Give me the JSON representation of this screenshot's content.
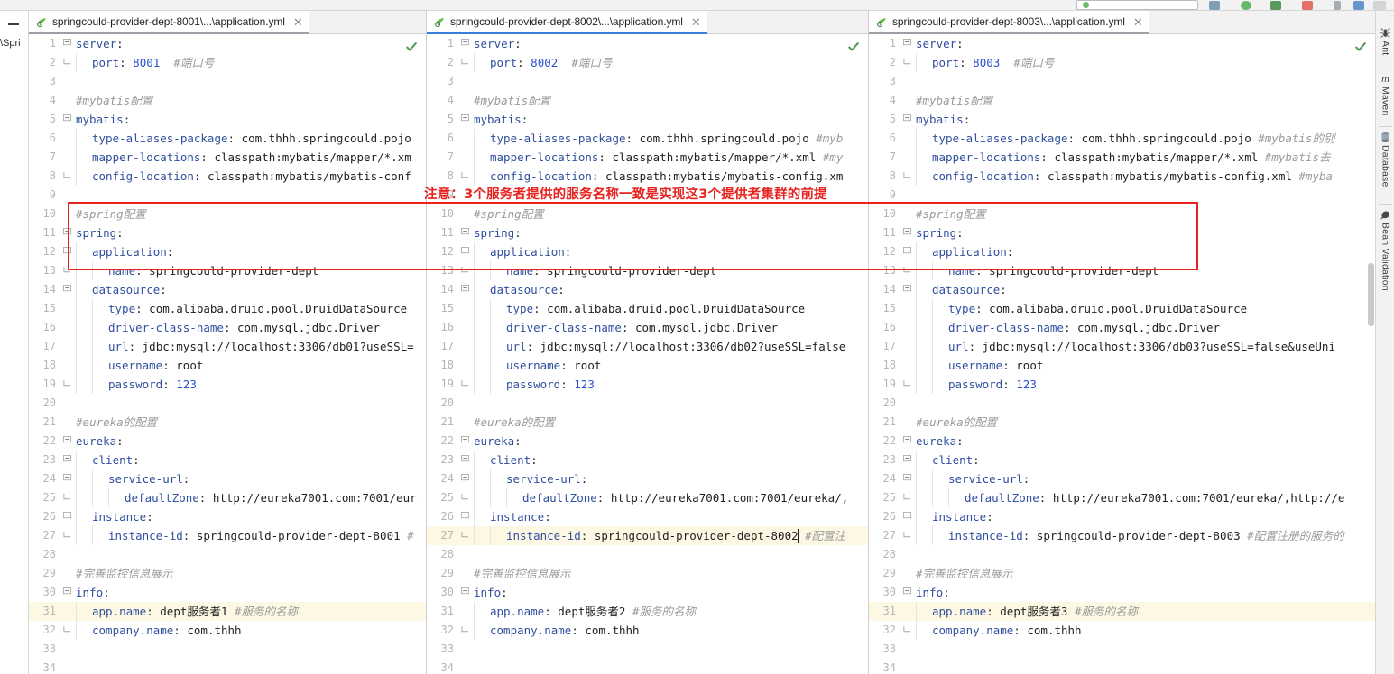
{
  "window": {
    "minimize_label": "—",
    "left_sliver_text": "\\Spri"
  },
  "annotation": {
    "text": "注意：3个服务者提供的服务名称一致是实现这3个提供者集群的前提",
    "color": "#e8231f"
  },
  "right_sidebar": {
    "items": [
      {
        "label": "Ant",
        "icon": "ant-icon"
      },
      {
        "label": "Maven",
        "icon": "maven-icon"
      },
      {
        "label": "Database",
        "icon": "database-icon"
      },
      {
        "label": "Bean Validation",
        "icon": "bean-validation-icon"
      }
    ]
  },
  "panes": [
    {
      "id": "pane-1",
      "tab": {
        "label": "springcould-provider-dept-8001\\...\\application.yml",
        "close": "✕",
        "icon": "spring-yml-icon",
        "active_style": "active-grey"
      },
      "inspection_status": "ok",
      "lines": [
        {
          "n": 1,
          "fold": "minus",
          "indent": 0,
          "text": "server:"
        },
        {
          "n": 2,
          "fold": "end",
          "indent": 1,
          "text": "port: 8001  #端口号"
        },
        {
          "n": 3,
          "fold": "",
          "indent": 0,
          "text": ""
        },
        {
          "n": 4,
          "fold": "",
          "indent": 0,
          "text": "#mybatis配置"
        },
        {
          "n": 5,
          "fold": "minus",
          "indent": 0,
          "text": "mybatis:"
        },
        {
          "n": 6,
          "fold": "",
          "indent": 1,
          "text": "type-aliases-package: com.thhh.springcould.pojo"
        },
        {
          "n": 7,
          "fold": "",
          "indent": 1,
          "text": "mapper-locations: classpath:mybatis/mapper/*.xm"
        },
        {
          "n": 8,
          "fold": "end",
          "indent": 1,
          "text": "config-location: classpath:mybatis/mybatis-conf"
        },
        {
          "n": 9,
          "fold": "",
          "indent": 0,
          "text": ""
        },
        {
          "n": 10,
          "fold": "",
          "indent": 0,
          "text": "#spring配置"
        },
        {
          "n": 11,
          "fold": "minus",
          "indent": 0,
          "text": "spring:"
        },
        {
          "n": 12,
          "fold": "minus",
          "indent": 1,
          "text": "application:"
        },
        {
          "n": 13,
          "fold": "end",
          "indent": 2,
          "text": "name: springcould-provider-dept"
        },
        {
          "n": 14,
          "fold": "minus",
          "indent": 1,
          "text": "datasource:"
        },
        {
          "n": 15,
          "fold": "",
          "indent": 2,
          "text": "type: com.alibaba.druid.pool.DruidDataSource"
        },
        {
          "n": 16,
          "fold": "",
          "indent": 2,
          "text": "driver-class-name: com.mysql.jdbc.Driver"
        },
        {
          "n": 17,
          "fold": "",
          "indent": 2,
          "text": "url: jdbc:mysql://localhost:3306/db01?useSSL="
        },
        {
          "n": 18,
          "fold": "",
          "indent": 2,
          "text": "username: root"
        },
        {
          "n": 19,
          "fold": "end",
          "indent": 2,
          "text": "password: 123"
        },
        {
          "n": 20,
          "fold": "",
          "indent": 0,
          "text": ""
        },
        {
          "n": 21,
          "fold": "",
          "indent": 0,
          "text": "#eureka的配置"
        },
        {
          "n": 22,
          "fold": "minus",
          "indent": 0,
          "text": "eureka:"
        },
        {
          "n": 23,
          "fold": "minus",
          "indent": 1,
          "text": "client:"
        },
        {
          "n": 24,
          "fold": "minus",
          "indent": 2,
          "text": "service-url:"
        },
        {
          "n": 25,
          "fold": "end",
          "indent": 3,
          "text": "defaultZone: http://eureka7001.com:7001/eur"
        },
        {
          "n": 26,
          "fold": "minus",
          "indent": 1,
          "text": "instance:"
        },
        {
          "n": 27,
          "fold": "end",
          "indent": 2,
          "text": "instance-id: springcould-provider-dept-8001 #"
        },
        {
          "n": 28,
          "fold": "",
          "indent": 0,
          "text": ""
        },
        {
          "n": 29,
          "fold": "",
          "indent": 0,
          "text": "#完善监控信息展示"
        },
        {
          "n": 30,
          "fold": "minus",
          "indent": 0,
          "text": "info:"
        },
        {
          "n": 31,
          "fold": "",
          "indent": 1,
          "text": "app.name: dept服务者1 #服务的名称",
          "highlight": true
        },
        {
          "n": 32,
          "fold": "end",
          "indent": 1,
          "text": "company.name: com.thhh"
        },
        {
          "n": 33,
          "fold": "",
          "indent": 0,
          "text": ""
        },
        {
          "n": 34,
          "fold": "",
          "indent": 0,
          "text": ""
        }
      ]
    },
    {
      "id": "pane-2",
      "tab": {
        "label": "springcould-provider-dept-8002\\...\\application.yml",
        "close": "✕",
        "icon": "spring-yml-icon",
        "active_style": "active-blue"
      },
      "inspection_status": "ok",
      "lines": [
        {
          "n": 1,
          "fold": "minus",
          "indent": 0,
          "text": "server:"
        },
        {
          "n": 2,
          "fold": "end",
          "indent": 1,
          "text": "port: 8002  #端口号"
        },
        {
          "n": 3,
          "fold": "",
          "indent": 0,
          "text": ""
        },
        {
          "n": 4,
          "fold": "",
          "indent": 0,
          "text": "#mybatis配置"
        },
        {
          "n": 5,
          "fold": "minus",
          "indent": 0,
          "text": "mybatis:"
        },
        {
          "n": 6,
          "fold": "",
          "indent": 1,
          "text": "type-aliases-package: com.thhh.springcould.pojo #myb"
        },
        {
          "n": 7,
          "fold": "",
          "indent": 1,
          "text": "mapper-locations: classpath:mybatis/mapper/*.xml #my"
        },
        {
          "n": 8,
          "fold": "end",
          "indent": 1,
          "text": "config-location: classpath:mybatis/mybatis-config.xm"
        },
        {
          "n": 9,
          "fold": "",
          "indent": 0,
          "text": ""
        },
        {
          "n": 10,
          "fold": "",
          "indent": 0,
          "text": "#spring配置"
        },
        {
          "n": 11,
          "fold": "minus",
          "indent": 0,
          "text": "spring:"
        },
        {
          "n": 12,
          "fold": "minus",
          "indent": 1,
          "text": "application:"
        },
        {
          "n": 13,
          "fold": "end",
          "indent": 2,
          "text": "name: springcould-provider-dept"
        },
        {
          "n": 14,
          "fold": "minus",
          "indent": 1,
          "text": "datasource:"
        },
        {
          "n": 15,
          "fold": "",
          "indent": 2,
          "text": "type: com.alibaba.druid.pool.DruidDataSource"
        },
        {
          "n": 16,
          "fold": "",
          "indent": 2,
          "text": "driver-class-name: com.mysql.jdbc.Driver"
        },
        {
          "n": 17,
          "fold": "",
          "indent": 2,
          "text": "url: jdbc:mysql://localhost:3306/db02?useSSL=false"
        },
        {
          "n": 18,
          "fold": "",
          "indent": 2,
          "text": "username: root"
        },
        {
          "n": 19,
          "fold": "end",
          "indent": 2,
          "text": "password: 123"
        },
        {
          "n": 20,
          "fold": "",
          "indent": 0,
          "text": ""
        },
        {
          "n": 21,
          "fold": "",
          "indent": 0,
          "text": "#eureka的配置"
        },
        {
          "n": 22,
          "fold": "minus",
          "indent": 0,
          "text": "eureka:"
        },
        {
          "n": 23,
          "fold": "minus",
          "indent": 1,
          "text": "client:"
        },
        {
          "n": 24,
          "fold": "minus",
          "indent": 2,
          "text": "service-url:"
        },
        {
          "n": 25,
          "fold": "end",
          "indent": 3,
          "text": "defaultZone: http://eureka7001.com:7001/eureka/,"
        },
        {
          "n": 26,
          "fold": "minus",
          "indent": 1,
          "text": "instance:"
        },
        {
          "n": 27,
          "fold": "end",
          "indent": 2,
          "text": "instance-id: springcould-provider-dept-8002 #配置注",
          "highlight": true,
          "caret_after": "instance-id: springcould-provider-dept-8002"
        },
        {
          "n": 28,
          "fold": "",
          "indent": 0,
          "text": ""
        },
        {
          "n": 29,
          "fold": "",
          "indent": 0,
          "text": "#完善监控信息展示"
        },
        {
          "n": 30,
          "fold": "minus",
          "indent": 0,
          "text": "info:"
        },
        {
          "n": 31,
          "fold": "",
          "indent": 1,
          "text": "app.name: dept服务者2 #服务的名称"
        },
        {
          "n": 32,
          "fold": "end",
          "indent": 1,
          "text": "company.name: com.thhh"
        },
        {
          "n": 33,
          "fold": "",
          "indent": 0,
          "text": ""
        },
        {
          "n": 34,
          "fold": "",
          "indent": 0,
          "text": ""
        }
      ]
    },
    {
      "id": "pane-3",
      "tab": {
        "label": "springcould-provider-dept-8003\\...\\application.yml",
        "close": "✕",
        "icon": "spring-yml-icon",
        "active_style": "active-grey"
      },
      "inspection_status": "ok",
      "lines": [
        {
          "n": 1,
          "fold": "minus",
          "indent": 0,
          "text": "server:"
        },
        {
          "n": 2,
          "fold": "end",
          "indent": 1,
          "text": "port: 8003  #端口号"
        },
        {
          "n": 3,
          "fold": "",
          "indent": 0,
          "text": ""
        },
        {
          "n": 4,
          "fold": "",
          "indent": 0,
          "text": "#mybatis配置"
        },
        {
          "n": 5,
          "fold": "minus",
          "indent": 0,
          "text": "mybatis:"
        },
        {
          "n": 6,
          "fold": "",
          "indent": 1,
          "text": "type-aliases-package: com.thhh.springcould.pojo #mybatis的别"
        },
        {
          "n": 7,
          "fold": "",
          "indent": 1,
          "text": "mapper-locations: classpath:mybatis/mapper/*.xml #mybatis去"
        },
        {
          "n": 8,
          "fold": "end",
          "indent": 1,
          "text": "config-location: classpath:mybatis/mybatis-config.xml #myba"
        },
        {
          "n": 9,
          "fold": "",
          "indent": 0,
          "text": ""
        },
        {
          "n": 10,
          "fold": "",
          "indent": 0,
          "text": "#spring配置"
        },
        {
          "n": 11,
          "fold": "minus",
          "indent": 0,
          "text": "spring:"
        },
        {
          "n": 12,
          "fold": "minus",
          "indent": 1,
          "text": "application:"
        },
        {
          "n": 13,
          "fold": "end",
          "indent": 2,
          "text": "name: springcould-provider-dept"
        },
        {
          "n": 14,
          "fold": "minus",
          "indent": 1,
          "text": "datasource:"
        },
        {
          "n": 15,
          "fold": "",
          "indent": 2,
          "text": "type: com.alibaba.druid.pool.DruidDataSource"
        },
        {
          "n": 16,
          "fold": "",
          "indent": 2,
          "text": "driver-class-name: com.mysql.jdbc.Driver"
        },
        {
          "n": 17,
          "fold": "",
          "indent": 2,
          "text": "url: jdbc:mysql://localhost:3306/db03?useSSL=false&useUni"
        },
        {
          "n": 18,
          "fold": "",
          "indent": 2,
          "text": "username: root"
        },
        {
          "n": 19,
          "fold": "end",
          "indent": 2,
          "text": "password: 123"
        },
        {
          "n": 20,
          "fold": "",
          "indent": 0,
          "text": ""
        },
        {
          "n": 21,
          "fold": "",
          "indent": 0,
          "text": "#eureka的配置"
        },
        {
          "n": 22,
          "fold": "minus",
          "indent": 0,
          "text": "eureka:"
        },
        {
          "n": 23,
          "fold": "minus",
          "indent": 1,
          "text": "client:"
        },
        {
          "n": 24,
          "fold": "minus",
          "indent": 2,
          "text": "service-url:"
        },
        {
          "n": 25,
          "fold": "end",
          "indent": 3,
          "text": "defaultZone: http://eureka7001.com:7001/eureka/,http://e"
        },
        {
          "n": 26,
          "fold": "minus",
          "indent": 1,
          "text": "instance:"
        },
        {
          "n": 27,
          "fold": "end",
          "indent": 2,
          "text": "instance-id: springcould-provider-dept-8003 #配置注册的服务的"
        },
        {
          "n": 28,
          "fold": "",
          "indent": 0,
          "text": ""
        },
        {
          "n": 29,
          "fold": "",
          "indent": 0,
          "text": "#完善监控信息展示"
        },
        {
          "n": 30,
          "fold": "minus",
          "indent": 0,
          "text": "info:"
        },
        {
          "n": 31,
          "fold": "",
          "indent": 1,
          "text": "app.name: dept服务者3 #服务的名称",
          "highlight": true
        },
        {
          "n": 32,
          "fold": "end",
          "indent": 1,
          "text": "company.name: com.thhh"
        },
        {
          "n": 33,
          "fold": "",
          "indent": 0,
          "text": ""
        },
        {
          "n": 34,
          "fold": "",
          "indent": 0,
          "text": ""
        }
      ]
    }
  ]
}
